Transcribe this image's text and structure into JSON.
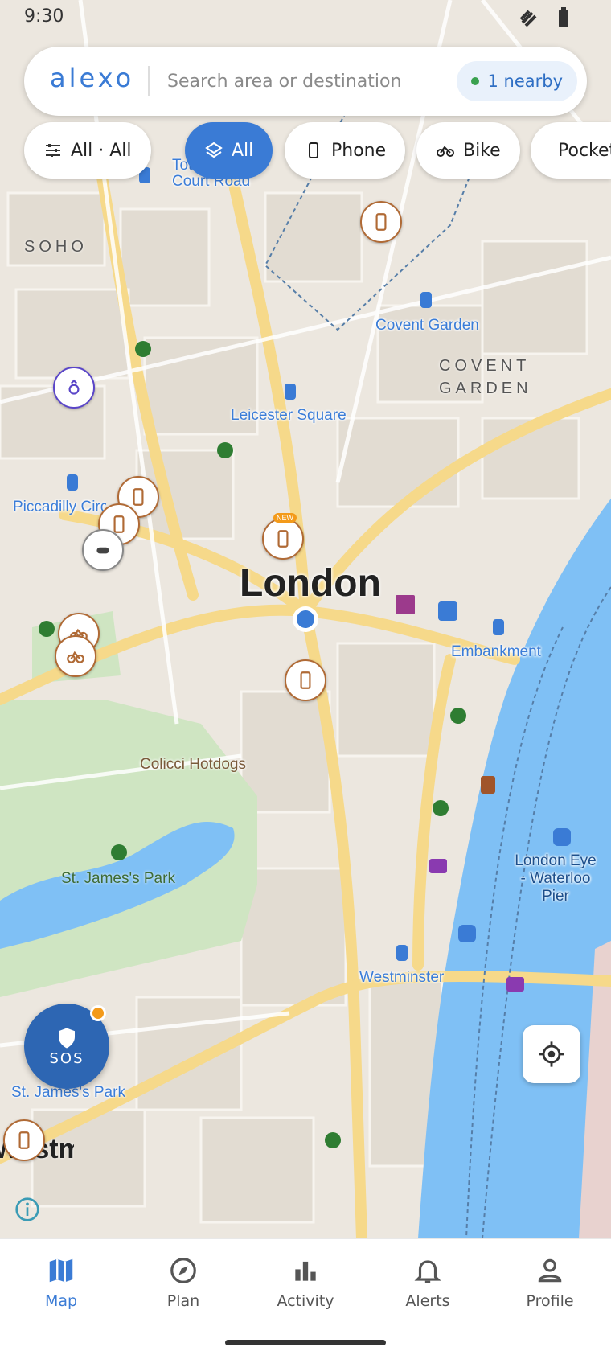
{
  "status_bar": {
    "time": "9:30"
  },
  "search": {
    "brand": "alexo",
    "placeholder": "Search area or destination",
    "nearby_label": "1 nearby"
  },
  "filters": {
    "settings_label": "All · All",
    "chips": [
      {
        "label": "All",
        "icon": "layers-icon",
        "active": true
      },
      {
        "label": "Phone",
        "icon": "phone-icon",
        "active": false
      },
      {
        "label": "Bike",
        "icon": "bike-icon",
        "active": false
      },
      {
        "label": "Pocket",
        "icon": "hand-icon",
        "active": false
      }
    ]
  },
  "map": {
    "city_label": "London",
    "districts": [
      "SOHO",
      "COVENT",
      "GARDEN"
    ],
    "stations": [
      "Covent Garden",
      "Leicester Square",
      "Piccadilly Circus",
      "Embankment",
      "Westminster",
      "St. James's Park",
      "Tottenham Court Road"
    ],
    "places": [
      "Colicci Hotdogs",
      "St. James's Park",
      "London Eye - Waterloo Pier",
      "Westminster"
    ],
    "pin_badge": "NEW"
  },
  "sos": {
    "label": "SOS"
  },
  "nav": {
    "items": [
      {
        "label": "Map",
        "icon": "map-icon",
        "active": true
      },
      {
        "label": "Plan",
        "icon": "compass-icon",
        "active": false
      },
      {
        "label": "Activity",
        "icon": "bar-chart-icon",
        "active": false
      },
      {
        "label": "Alerts",
        "icon": "bell-icon",
        "active": false
      },
      {
        "label": "Profile",
        "icon": "person-icon",
        "active": false
      }
    ]
  },
  "colors": {
    "accent": "#3a7bd5",
    "water": "#7fc0f5",
    "park": "#cfe5c2",
    "road": "#f8d98a",
    "pin": "#b06a35"
  }
}
